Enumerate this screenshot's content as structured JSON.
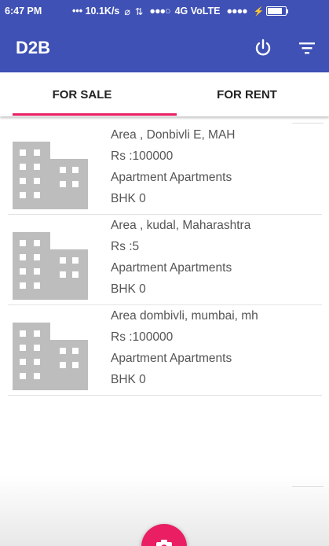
{
  "status_bar": {
    "time": "6:47 PM",
    "network_speed": "••• 10.1K/s",
    "carrier": "4G VoLTE",
    "signal_dots": "●●●○",
    "signal_dots_2": "●●●●",
    "battery_charging": true,
    "battery_level": 0.85
  },
  "app_bar": {
    "title": "D2B",
    "power_icon": "power-icon",
    "filter_icon": "filter-icon"
  },
  "tabs": [
    {
      "label": "FOR SALE",
      "selected": true
    },
    {
      "label": "FOR RENT",
      "selected": false
    }
  ],
  "accent_color": "#e91e63",
  "primary_color": "#3f51b5",
  "listings": [
    {
      "area": "Area , Donbivli E, MAH",
      "price": "Rs :100000",
      "type": "Apartment Apartments",
      "bhk": "BHK 0",
      "icon": "building-icon"
    },
    {
      "area": "Area , kudal, Maharashtra",
      "price": "Rs :5",
      "type": "Apartment Apartments",
      "bhk": "BHK 0",
      "icon": "building-icon"
    },
    {
      "area": "Area dombivli, mumbai, mh",
      "price": "Rs :100000",
      "type": "Apartment Apartments",
      "bhk": "BHK 0",
      "icon": "building-icon"
    }
  ],
  "fab_icon": "camera-icon"
}
